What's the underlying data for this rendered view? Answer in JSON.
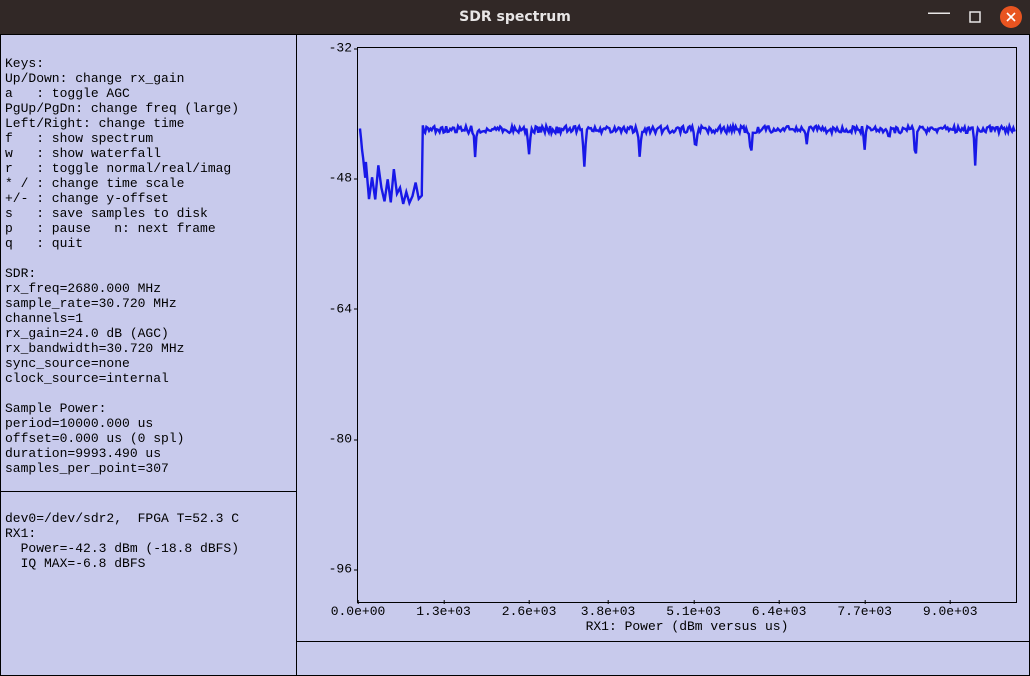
{
  "window": {
    "title": "SDR spectrum"
  },
  "colors": {
    "trace": "#1818e8"
  },
  "sidebar": {
    "keys_block": "Keys:\nUp/Down: change rx_gain\na   : toggle AGC\nPgUp/PgDn: change freq (large)\nLeft/Right: change time\nf   : show spectrum\nw   : show waterfall\nr   : toggle normal/real/imag\n* / : change time scale\n+/- : change y-offset\ns   : save samples to disk\np   : pause   n: next frame\nq   : quit",
    "sdr_block": "SDR:\nrx_freq=2680.000 MHz\nsample_rate=30.720 MHz\nchannels=1\nrx_gain=24.0 dB (AGC)\nrx_bandwidth=30.720 MHz\nsync_source=none\nclock_source=internal",
    "sample_block": "Sample Power:\nperiod=10000.000 us\noffset=0.000 us (0 spl)\nduration=9993.490 us\nsamples_per_point=307",
    "device_block": "dev0=/dev/sdr2,  FPGA T=52.3 C\nRX1:\n  Power=-42.3 dBm (-18.8 dBFS)\n  IQ MAX=-6.8 dBFS"
  },
  "chart_data": {
    "type": "line",
    "title": "",
    "xlabel": "RX1: Power (dBm versus us)",
    "ylabel": "",
    "xlim": [
      0,
      10000
    ],
    "ylim": [
      -100,
      -32
    ],
    "x_ticks": [
      {
        "v": 0,
        "l": "0.0e+00"
      },
      {
        "v": 1300,
        "l": "1.3e+03"
      },
      {
        "v": 2600,
        "l": "2.6e+03"
      },
      {
        "v": 3800,
        "l": "3.8e+03"
      },
      {
        "v": 5100,
        "l": "5.1e+03"
      },
      {
        "v": 6400,
        "l": "6.4e+03"
      },
      {
        "v": 7700,
        "l": "7.7e+03"
      },
      {
        "v": 9000,
        "l": "9.0e+03"
      }
    ],
    "y_ticks": [
      -32,
      -48,
      -64,
      -80,
      -96
    ],
    "baseline": -42,
    "floor": -51,
    "noise_amp": 0.9,
    "early_segment_end": 970,
    "dips": [
      {
        "x": 1780,
        "depth": 3.5
      },
      {
        "x": 2595,
        "depth": 4.0
      },
      {
        "x": 3440,
        "depth": 5.0
      },
      {
        "x": 4285,
        "depth": 4.0
      },
      {
        "x": 5130,
        "depth": 3.2
      },
      {
        "x": 5975,
        "depth": 3.8
      },
      {
        "x": 6820,
        "depth": 1.5
      },
      {
        "x": 7700,
        "depth": 2.2
      },
      {
        "x": 8070,
        "depth": 2.0
      },
      {
        "x": 8470,
        "depth": 4.4
      },
      {
        "x": 9380,
        "depth": 4.0
      }
    ]
  }
}
